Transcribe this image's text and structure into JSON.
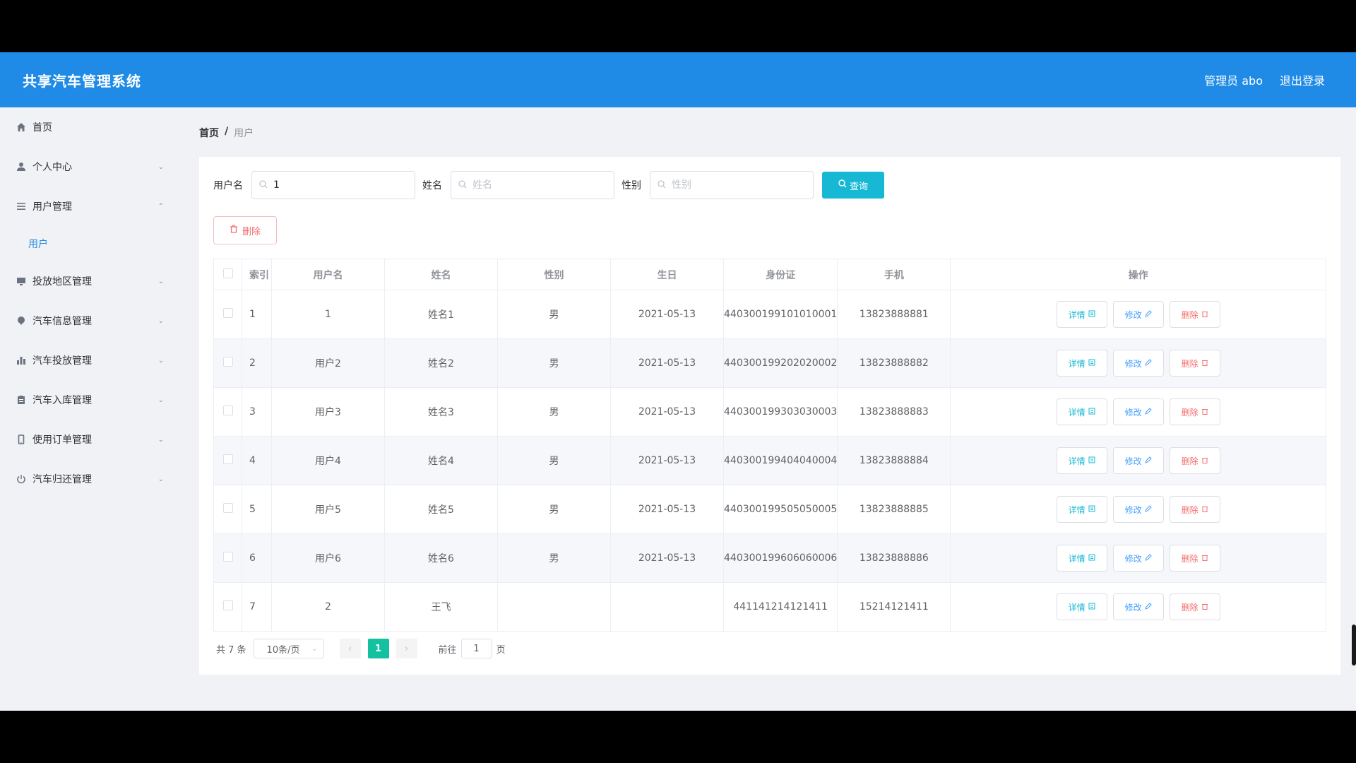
{
  "header": {
    "title": "共享汽车管理系统",
    "user": "管理员 abo",
    "logout": "退出登录"
  },
  "sidebar": {
    "items": [
      {
        "label": "首页",
        "icon": "home-icon",
        "chevron": ""
      },
      {
        "label": "个人中心",
        "icon": "user-icon",
        "chevron": "⌄"
      },
      {
        "label": "用户管理",
        "icon": "list-icon",
        "chevron": "⌃"
      },
      {
        "label": "投放地区管理",
        "icon": "monitor-icon",
        "chevron": "⌄"
      },
      {
        "label": "汽车信息管理",
        "icon": "pin-icon",
        "chevron": "⌄"
      },
      {
        "label": "汽车投放管理",
        "icon": "bar-chart-icon",
        "chevron": "⌄"
      },
      {
        "label": "汽车入库管理",
        "icon": "clipboard-icon",
        "chevron": "⌄"
      },
      {
        "label": "使用订单管理",
        "icon": "phone-icon",
        "chevron": "⌄"
      },
      {
        "label": "汽车归还管理",
        "icon": "power-icon",
        "chevron": "⌄"
      }
    ],
    "sub_item": "用户"
  },
  "breadcrumb": {
    "home": "首页",
    "sep": "/",
    "current": "用户"
  },
  "search": {
    "username_label": "用户名",
    "username_value": "1",
    "name_label": "姓名",
    "name_placeholder": "姓名",
    "gender_label": "性别",
    "gender_placeholder": "性别",
    "query_button": "查询"
  },
  "delete_button": "删除",
  "table": {
    "headers": [
      "索引",
      "用户名",
      "姓名",
      "性别",
      "生日",
      "身份证",
      "手机",
      "操作"
    ],
    "rows": [
      [
        "1",
        "1",
        "姓名1",
        "男",
        "2021-05-13",
        "440300199101010001",
        "13823888881"
      ],
      [
        "2",
        "用户2",
        "姓名2",
        "男",
        "2021-05-13",
        "440300199202020002",
        "13823888882"
      ],
      [
        "3",
        "用户3",
        "姓名3",
        "男",
        "2021-05-13",
        "440300199303030003",
        "13823888883"
      ],
      [
        "4",
        "用户4",
        "姓名4",
        "男",
        "2021-05-13",
        "440300199404040004",
        "13823888884"
      ],
      [
        "5",
        "用户5",
        "姓名5",
        "男",
        "2021-05-13",
        "440300199505050005",
        "13823888885"
      ],
      [
        "6",
        "用户6",
        "姓名6",
        "男",
        "2021-05-13",
        "440300199606060006",
        "13823888886"
      ],
      [
        "7",
        "2",
        "王飞",
        "",
        "",
        "441141214121411",
        "15214121411"
      ]
    ],
    "ops": {
      "detail": "详情",
      "edit": "修改",
      "delete": "删除"
    }
  },
  "pagination": {
    "total": "共 7 条",
    "page_size": "10条/页",
    "current_page": "1",
    "goto_label": "前往",
    "goto_value": "1",
    "page_unit": "页"
  },
  "colors": {
    "header": "#1f8be6",
    "query": "#17b8d3",
    "page_active": "#13c0a0",
    "danger": "#f56c6c"
  }
}
